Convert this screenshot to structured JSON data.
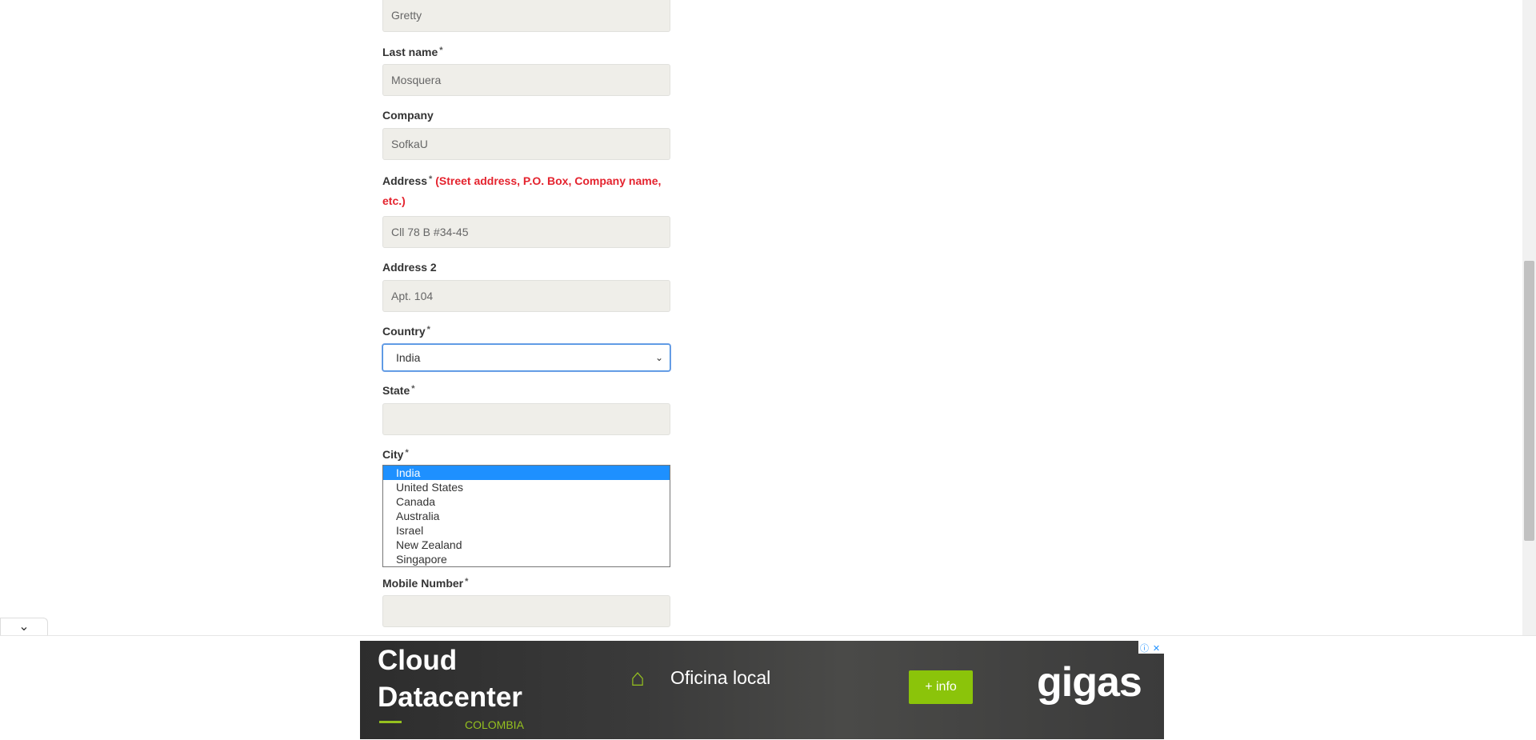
{
  "form": {
    "first_name_value": "Gretty",
    "last_name": {
      "label": "Last name",
      "required": "*",
      "value": "Mosquera"
    },
    "company": {
      "label": "Company",
      "value": "SofkaU"
    },
    "address": {
      "label": "Address",
      "required": "*",
      "hint_line1": "(Street address, P.O. Box, Company name,",
      "hint_line2": "etc.)",
      "value": "Cll 78 B #34-45"
    },
    "address2": {
      "label": "Address 2",
      "value": "Apt. 104"
    },
    "country": {
      "label": "Country",
      "required": "*",
      "value": "India"
    },
    "state": {
      "label": "State",
      "required": "*",
      "value": ""
    },
    "city": {
      "label": "City",
      "required": "*"
    },
    "mobile": {
      "label": "Mobile Number",
      "required": "*",
      "value": ""
    }
  },
  "country_options": [
    "India",
    "United States",
    "Canada",
    "Australia",
    "Israel",
    "New Zealand",
    "Singapore"
  ],
  "ad": {
    "title_line1": "Cloud",
    "title_line2": "Datacenter",
    "subtitle": "COLOMBIA",
    "office": "Oficina local",
    "button": "+ info",
    "brand": "gigas",
    "info_glyph": "ⓘ",
    "close_glyph": "✕",
    "accent": "#95c11f",
    "home_icon": "home-icon"
  },
  "collapse_glyph": "⌄"
}
